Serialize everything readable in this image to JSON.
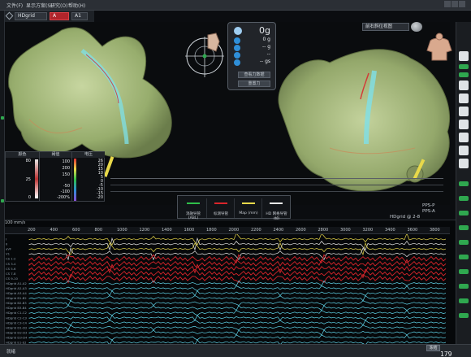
{
  "menu": {
    "items": [
      "文件(F)",
      "显示方案(S)",
      "研究(O)",
      "帮助(H)"
    ]
  },
  "map_toolbar": {
    "map_select": "HDgrid",
    "tag_select": "A",
    "tag2_select": "A1"
  },
  "force_panel": {
    "contact_force": "0g",
    "row1": "0 g",
    "row2": "-- g",
    "row3": "--",
    "row4": "-- gs",
    "btn1": "查看力数据",
    "btn2": "重置力"
  },
  "view_dropdown": "前右斜位视图",
  "lat_table": {
    "headers": [
      "颜色",
      "阈值",
      "电压"
    ],
    "col1": [
      "80",
      "",
      "",
      "25",
      "",
      "",
      "0"
    ],
    "col2": [
      "100",
      "200",
      "150",
      "",
      "-50",
      "-100",
      "-200%"
    ],
    "col3": [
      "26",
      "20",
      "15",
      "10",
      "5",
      "0",
      "-5",
      "-10",
      "-15",
      "-20"
    ]
  },
  "catheters": [
    {
      "label": "消融导管(ABL)",
      "color": "#2fbf4a"
    },
    {
      "label": "标测导管",
      "color": "#d9252b"
    },
    {
      "label": "Map (mm)",
      "color": "#e8d84a"
    },
    {
      "label": "HD 网格导管 (帧)",
      "color": "#e8e8e8"
    }
  ],
  "annotations": {
    "pps_p": "PPS-P",
    "pps_a": "PPS-A",
    "hd_grid": "HDgrid @ 2-8"
  },
  "egm": {
    "speed": "100 mm/s",
    "ruler_ticks": [
      "200",
      "400",
      "600",
      "800",
      "1000",
      "1200",
      "1400",
      "1600",
      "1800",
      "2000",
      "2200",
      "2400",
      "2600",
      "2800",
      "3000",
      "3200",
      "3400",
      "3600",
      "3800"
    ],
    "channel_labels": [
      "I",
      "II",
      "aVF",
      "V1",
      "CS 1-2",
      "CS 3-4",
      "CS 5-6",
      "CS 7-8",
      "CS 9-10",
      "HDgrid A1-A2",
      "HDgrid A2-A3",
      "HDgrid A3-A4",
      "HDgrid B1-B2",
      "HDgrid B2-B3",
      "HDgrid B3-B4",
      "HDgrid C1-C2",
      "HDgrid C2-C3",
      "HDgrid C3-C4",
      "HDgrid D1-D2",
      "HDgrid D2-D3",
      "HDgrid D3-D4",
      "HDgrid E1-E2"
    ]
  },
  "statusbar": {
    "left": "就绪",
    "status_button": "冻结",
    "counter": "179"
  },
  "colors": {
    "accent_red": "#b0252b",
    "egm_yellow": "#e8d84a",
    "egm_red": "#d9252b",
    "egm_cyan": "#5fd3e8",
    "heart_tissue": "#9fb57a"
  }
}
